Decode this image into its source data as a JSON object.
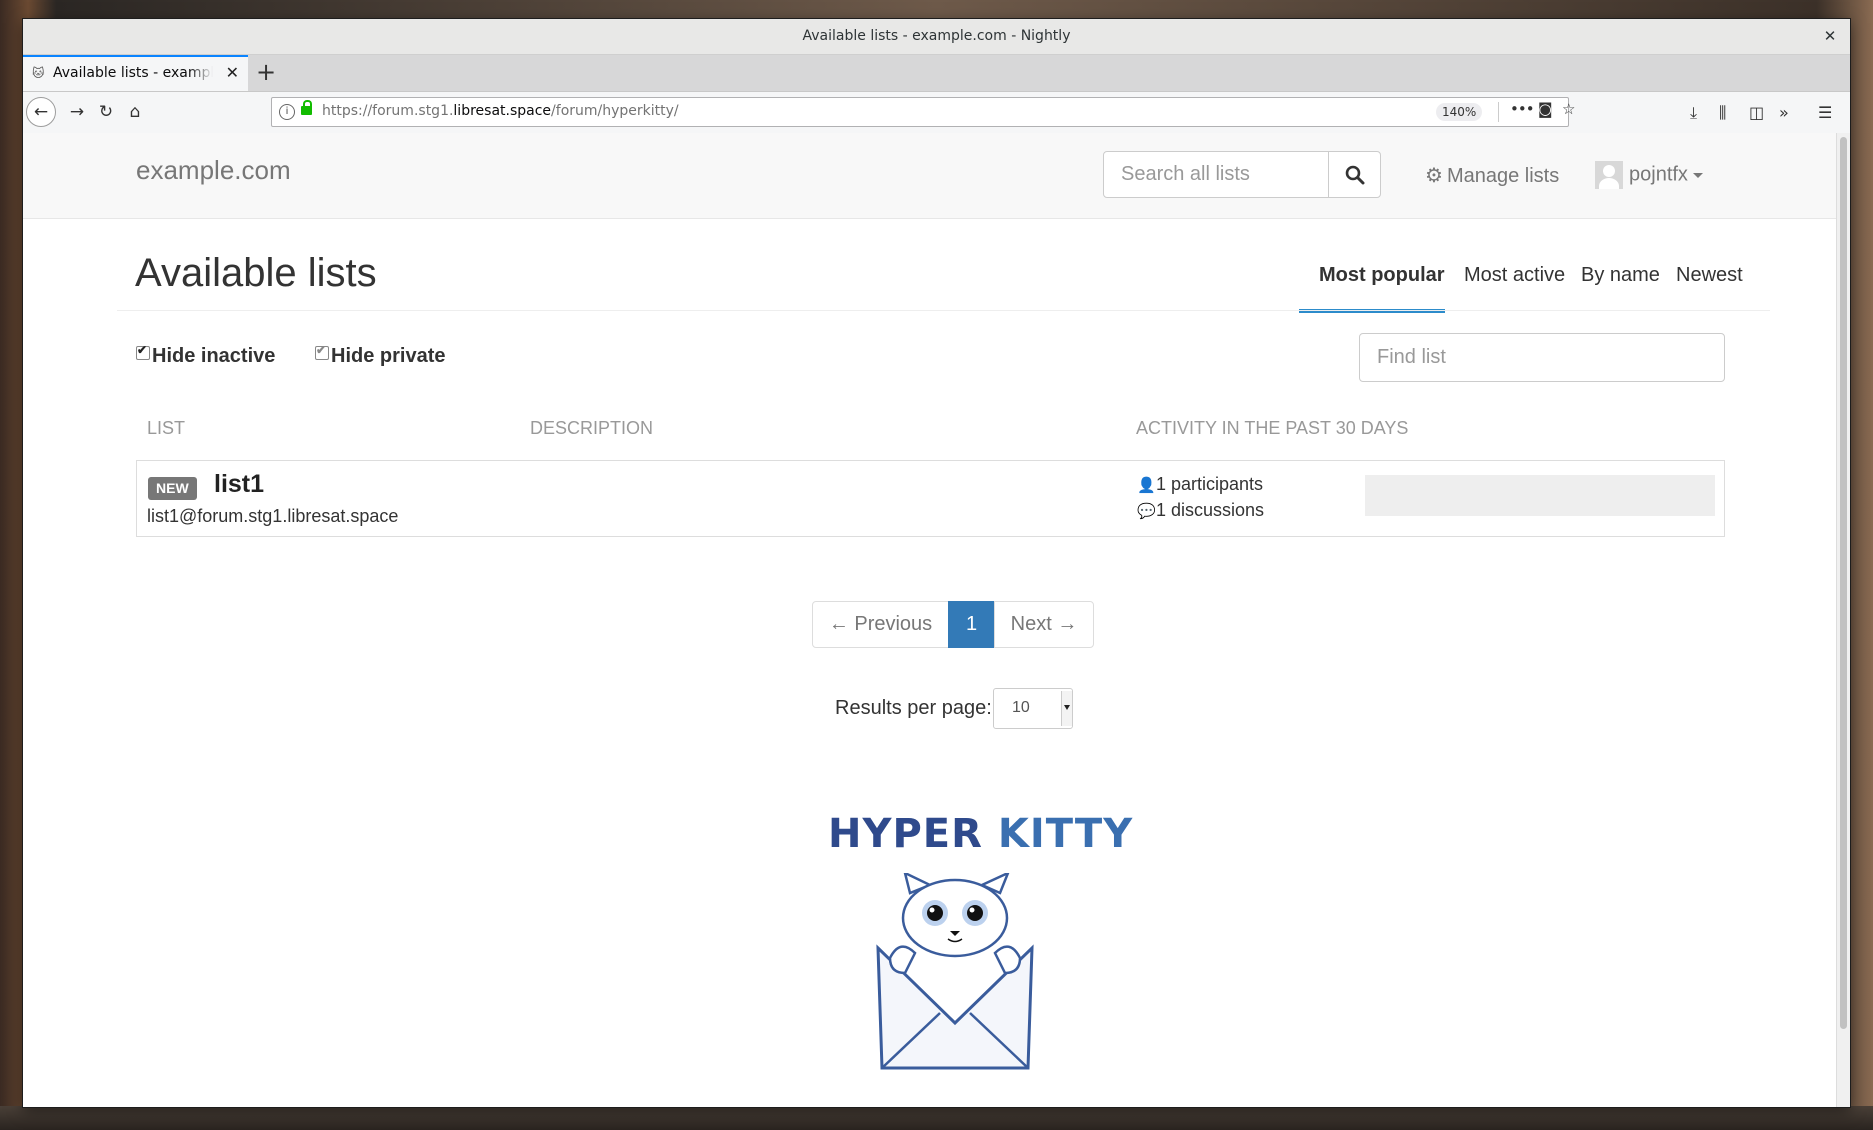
{
  "window": {
    "title": "Available lists - example.com - Nightly",
    "close_glyph": "✕"
  },
  "tab": {
    "label": "Available lists - example.com",
    "close_glyph": "✕",
    "new_tab_glyph": "+"
  },
  "navbar": {
    "url_prefix": "https://forum.stg1.",
    "url_host": "libresat.space",
    "url_path": "/forum/hyperkitty/",
    "zoom": "140%",
    "icons": [
      "back-icon",
      "forward-icon",
      "reload-icon",
      "home-icon",
      "page-actions-icon",
      "pocket-icon",
      "bookmark-star-icon",
      "downloads-icon",
      "library-icon",
      "sidebar-icon",
      "overflow-icon",
      "menu-icon"
    ]
  },
  "header": {
    "brand": "example.com",
    "search_placeholder": "Search all lists",
    "manage_lists": "Manage lists",
    "username": "pojntfx"
  },
  "main": {
    "title": "Available lists",
    "sort_tabs": [
      {
        "label": "Most popular",
        "active": true
      },
      {
        "label": "Most active",
        "active": false
      },
      {
        "label": "By name",
        "active": false
      },
      {
        "label": "Newest",
        "active": false
      }
    ],
    "filters": {
      "hide_inactive": "Hide inactive",
      "hide_private": "Hide private"
    },
    "find_placeholder": "Find list",
    "columns": [
      "List",
      "Description",
      "Activity in the past 30 days"
    ],
    "lists": [
      {
        "badge": "NEW",
        "name": "list1",
        "address": "list1@forum.stg1.libresat.space",
        "participants": "1 participants",
        "discussions": "1 discussions"
      }
    ],
    "pagination": {
      "previous": "← Previous",
      "current": "1",
      "next": "Next →"
    },
    "results_per_page_label": "Results per page:",
    "results_per_page_value": "10"
  },
  "footer_logo": {
    "word1": "HYPER",
    "word2": "KITTY"
  },
  "colors": {
    "accent": "#2d8ccb",
    "pagination_active": "#337ab7",
    "tab_accent": "#0a84ff",
    "secure_lock": "#12bc00"
  }
}
